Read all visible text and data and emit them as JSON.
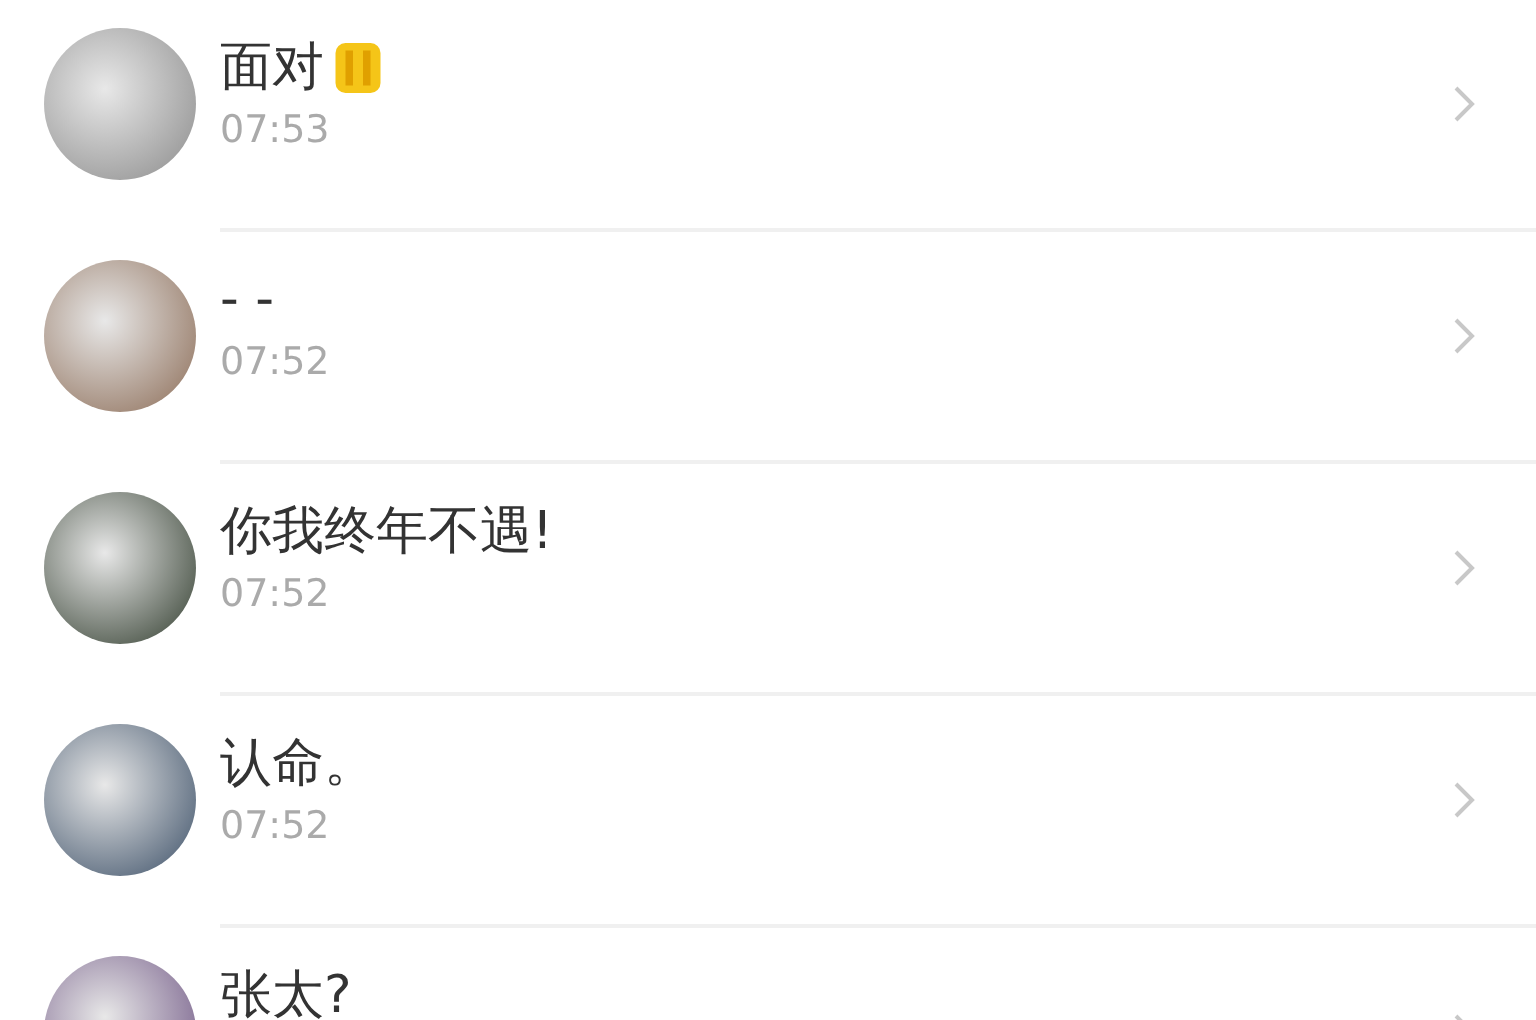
{
  "chats": [
    {
      "name": "面对",
      "emoji": true,
      "time": "07:53"
    },
    {
      "name": "- -",
      "emoji": false,
      "time": "07:52"
    },
    {
      "name": "你我终年不遇!",
      "emoji": false,
      "time": "07:52"
    },
    {
      "name": "认命。",
      "emoji": false,
      "time": "07:52"
    },
    {
      "name": "张太?",
      "emoji": false
    }
  ]
}
